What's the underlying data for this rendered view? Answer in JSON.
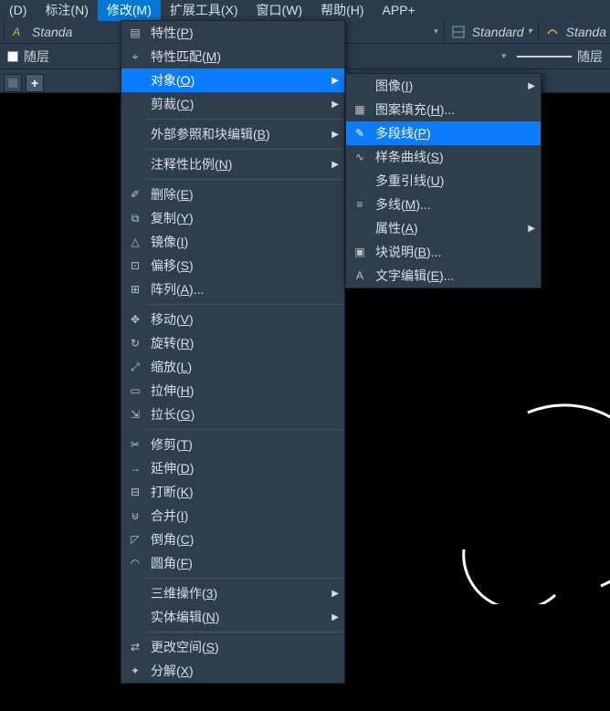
{
  "menubar": {
    "items": [
      {
        "label": "(D)"
      },
      {
        "label": "标注(N)"
      },
      {
        "label": "修改(M)",
        "active": true
      },
      {
        "label": "扩展工具(X)"
      },
      {
        "label": "窗口(W)"
      },
      {
        "label": "帮助(H)"
      },
      {
        "label": "APP+"
      }
    ]
  },
  "toolbar": {
    "style1": "Standa",
    "style2": "Standard",
    "style3": "Standa"
  },
  "layerbar": {
    "layer_label": "随层",
    "linetype_label": "随层"
  },
  "menu_main": [
    {
      "icon": "properties",
      "label": "特性(P)",
      "u": "P"
    },
    {
      "icon": "match",
      "label": "特性匹配(M)",
      "u": "M"
    },
    {
      "icon": "",
      "label": "对象(O)",
      "u": "O",
      "arrow": true,
      "hl": true
    },
    {
      "icon": "",
      "label": "剪裁(C)",
      "u": "C",
      "arrow": true
    },
    {
      "sep": true
    },
    {
      "icon": "",
      "label": "外部参照和块编辑(B)",
      "u": "B",
      "arrow": true
    },
    {
      "sep": true
    },
    {
      "icon": "",
      "label": "注释性比例(N)",
      "u": "N",
      "arrow": true
    },
    {
      "sep": true
    },
    {
      "icon": "erase",
      "label": "删除(E)",
      "u": "E"
    },
    {
      "icon": "copy",
      "label": "复制(Y)",
      "u": "Y"
    },
    {
      "icon": "mirror",
      "label": "镜像(I)",
      "u": "I"
    },
    {
      "icon": "offset",
      "label": "偏移(S)",
      "u": "S"
    },
    {
      "icon": "array",
      "label": "阵列(A)...",
      "u": "A"
    },
    {
      "sep": true
    },
    {
      "icon": "move",
      "label": "移动(V)",
      "u": "V"
    },
    {
      "icon": "rotate",
      "label": "旋转(R)",
      "u": "R"
    },
    {
      "icon": "scale",
      "label": "缩放(L)",
      "u": "L"
    },
    {
      "icon": "stretch",
      "label": "拉伸(H)",
      "u": "H"
    },
    {
      "icon": "lengthen",
      "label": "拉长(G)",
      "u": "G"
    },
    {
      "sep": true
    },
    {
      "icon": "trim",
      "label": "修剪(T)",
      "u": "T"
    },
    {
      "icon": "extend",
      "label": "延伸(D)",
      "u": "D"
    },
    {
      "icon": "break",
      "label": "打断(K)",
      "u": "K"
    },
    {
      "icon": "join",
      "label": "合并(I)",
      "u": "I"
    },
    {
      "icon": "chamfer",
      "label": "倒角(C)",
      "u": "C"
    },
    {
      "icon": "fillet",
      "label": "圆角(F)",
      "u": "F"
    },
    {
      "sep": true
    },
    {
      "icon": "",
      "label": "三维操作(3)",
      "u": "3",
      "arrow": true
    },
    {
      "icon": "",
      "label": "实体编辑(N)",
      "u": "N",
      "arrow": true
    },
    {
      "sep": true
    },
    {
      "icon": "chspace",
      "label": "更改空间(S)",
      "u": "S"
    },
    {
      "icon": "explode",
      "label": "分解(X)",
      "u": "X"
    }
  ],
  "menu_sub": [
    {
      "icon": "",
      "label": "图像(I)",
      "u": "I",
      "arrow": true
    },
    {
      "icon": "hatch",
      "label": "图案填充(H)...",
      "u": "H"
    },
    {
      "icon": "pline",
      "label": "多段线(P)",
      "u": "P",
      "hl": true
    },
    {
      "icon": "spline",
      "label": "样条曲线(S)",
      "u": "S"
    },
    {
      "icon": "",
      "label": "多重引线(U)",
      "u": "U"
    },
    {
      "icon": "mline",
      "label": "多线(M)...",
      "u": "M"
    },
    {
      "icon": "",
      "label": "属性(A)",
      "u": "A",
      "arrow": true
    },
    {
      "icon": "blk",
      "label": "块说明(B)...",
      "u": "B"
    },
    {
      "icon": "txt",
      "label": "文字编辑(E)...",
      "u": "E"
    }
  ]
}
